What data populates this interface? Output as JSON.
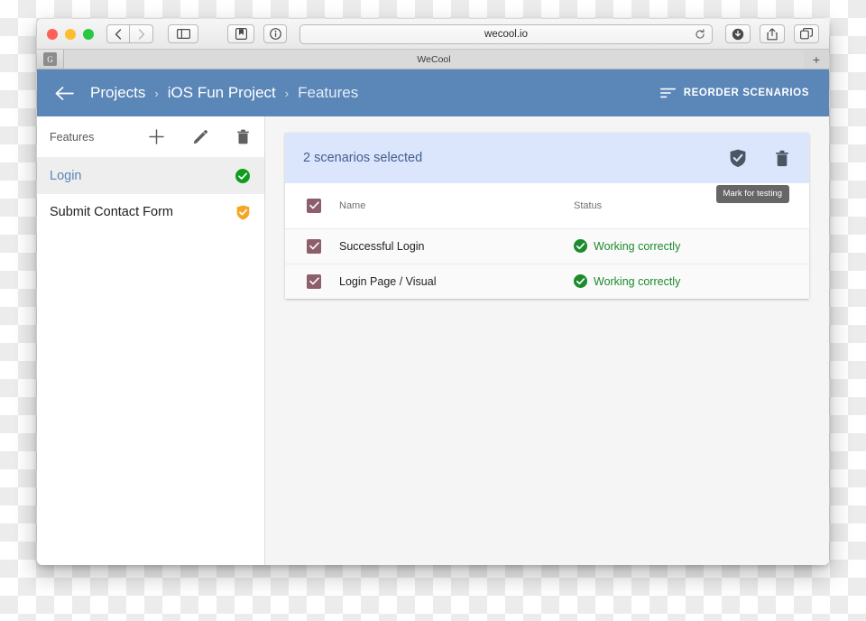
{
  "browser": {
    "traffic_lights": [
      "close",
      "minimize",
      "zoom"
    ],
    "nav": {
      "back": "back-icon",
      "forward": "forward-icon"
    },
    "sidebar_toggle": "sidebar-toggle-icon",
    "reader": "reader-icon",
    "info": "info-icon",
    "url": "wecool.io",
    "reload": "reload-icon",
    "downloads": "download-icon",
    "share": "share-icon",
    "tabs_overview": "tabs-icon",
    "tab_bar": {
      "favicon_letter": "G",
      "tab_title": "WeCool",
      "new_tab": "+"
    }
  },
  "app_header": {
    "back": "back-arrow-icon",
    "breadcrumbs": [
      {
        "label": "Projects",
        "muted": false
      },
      {
        "label": "iOS Fun Project",
        "muted": false
      },
      {
        "label": "Features",
        "muted": true
      }
    ],
    "separator": "›",
    "reorder_label": "REORDER SCENARIOS",
    "reorder_icon": "sort-icon",
    "background_color": "#5b86b8"
  },
  "sidebar": {
    "title": "Features",
    "actions": [
      {
        "name": "add",
        "icon": "plus-icon"
      },
      {
        "name": "edit",
        "icon": "pencil-icon"
      },
      {
        "name": "delete",
        "icon": "trash-icon"
      }
    ],
    "items": [
      {
        "label": "Login",
        "selected": true,
        "status_icon": "check-circle-icon",
        "status_color": "#0f9d1b"
      },
      {
        "label": "Submit Contact Form",
        "selected": false,
        "status_icon": "shield-check-icon",
        "status_color": "#f5a623"
      }
    ]
  },
  "main": {
    "selection_bar": {
      "text": "2 scenarios selected",
      "actions": [
        {
          "name": "mark-for-testing",
          "icon": "shield-check-icon"
        },
        {
          "name": "delete-scenarios",
          "icon": "trash-icon"
        }
      ],
      "background_color": "#dbe5fb",
      "text_color": "#45608f"
    },
    "tooltip": "Mark for testing",
    "table": {
      "columns": [
        "",
        "Name",
        "Status"
      ],
      "header_checkbox_checked": true,
      "rows": [
        {
          "checked": true,
          "name": "Successful Login",
          "status": "Working correctly",
          "status_icon": "check-circle-icon",
          "status_color": "#1b8b2b"
        },
        {
          "checked": true,
          "name": "Login Page / Visual",
          "status": "Working correctly",
          "status_icon": "check-circle-icon",
          "status_color": "#1b8b2b"
        }
      ],
      "checkbox_color": "#8d5f6d"
    }
  }
}
